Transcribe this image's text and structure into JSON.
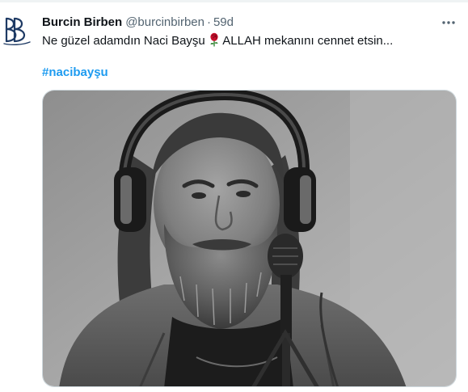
{
  "tweet": {
    "author": {
      "display_name": "Burcin Birben",
      "handle": "@burcinbirben",
      "avatar_icon": "bb-monogram-logo"
    },
    "separator": "·",
    "timestamp": "59d",
    "text_before_emoji": "Ne güzel adamdın Naci Bayşu ",
    "emoji": "rose-icon",
    "text_after_emoji": " ALLAH mekanını cennet etsin...",
    "hashtag": "#nacibayşu",
    "more_icon": "more-horizontal-icon",
    "media": {
      "type": "photo",
      "style": "black-and-white portrait of a bearded man wearing headphones at a microphone"
    }
  },
  "colors": {
    "text_primary": "#0f1419",
    "text_secondary": "#536471",
    "hashtag": "#1d9bf0",
    "border": "#cfd9de",
    "avatar_navy": "#1e3a64"
  }
}
